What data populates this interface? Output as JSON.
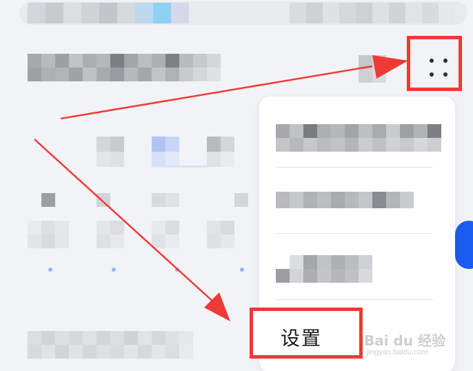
{
  "menu": {
    "settings_label": "设置"
  },
  "watermark": {
    "brand": "Bai du 经验",
    "url": "jingyan.baidu.com"
  },
  "colors": {
    "highlight": "#ee3a36",
    "arrow": "#ee3a36",
    "accent_blue": "#1a5cf0",
    "page_background": "#f2f3f7",
    "menu_background": "#ffffff"
  },
  "icons": {
    "more_button": "four-dots-icon"
  }
}
